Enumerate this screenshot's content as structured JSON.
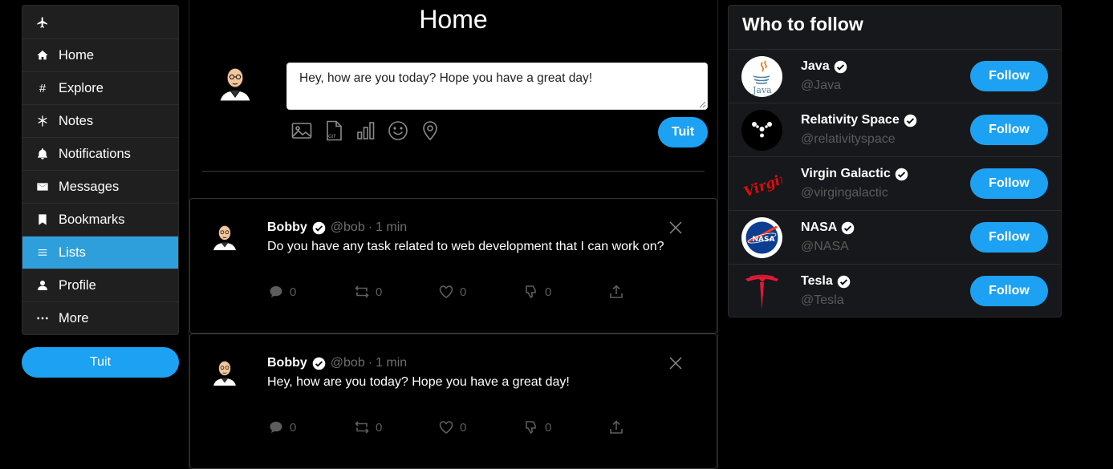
{
  "sidebar": {
    "items": [
      {
        "label": "",
        "icon": "airplane-icon"
      },
      {
        "label": "Home",
        "icon": "home-icon"
      },
      {
        "label": "Explore",
        "icon": "hashtag-icon"
      },
      {
        "label": "Notes",
        "icon": "asterisk-icon"
      },
      {
        "label": "Notifications",
        "icon": "bell-icon"
      },
      {
        "label": "Messages",
        "icon": "envelope-icon"
      },
      {
        "label": "Bookmarks",
        "icon": "bookmark-icon"
      },
      {
        "label": "Lists",
        "icon": "list-icon",
        "active": true
      },
      {
        "label": "Profile",
        "icon": "user-icon"
      },
      {
        "label": "More",
        "icon": "more-icon"
      }
    ],
    "tuit_label": "Tuit"
  },
  "main": {
    "title": "Home",
    "compose": {
      "text": "Hey, how are you today? Hope you have a great day!",
      "tools": [
        "image-icon",
        "gif-icon",
        "poll-icon",
        "emoji-icon",
        "location-icon"
      ],
      "tuit_label": "Tuit"
    },
    "tweets": [
      {
        "name": "Bobby",
        "handle": "@bob",
        "separator": "·",
        "time": "1 min",
        "text": "Do you have any task related to web development that I can work on?",
        "replies": "0",
        "retuits": "0",
        "likes": "0",
        "dislikes": "0"
      },
      {
        "name": "Bobby",
        "handle": "@bob",
        "separator": "·",
        "time": "1 min",
        "text": "Hey, how are you today? Hope you have a great day!",
        "replies": "0",
        "retuits": "0",
        "likes": "0",
        "dislikes": "0"
      }
    ]
  },
  "who_to_follow": {
    "title": "Who to follow",
    "button_label": "Follow",
    "accounts": [
      {
        "name": "Java",
        "handle": "@Java",
        "logo_text": "Java",
        "logo": "java-logo"
      },
      {
        "name": "Relativity Space",
        "handle": "@relativityspace",
        "logo": "relativity-logo"
      },
      {
        "name": "Virgin Galactic",
        "handle": "@virgingalactic",
        "logo_text": "Virgin",
        "logo": "virgin-logo"
      },
      {
        "name": "NASA",
        "handle": "@NASA",
        "logo_text": "NASA",
        "logo": "nasa-logo"
      },
      {
        "name": "Tesla",
        "handle": "@Tesla",
        "logo": "tesla-logo"
      }
    ]
  },
  "colors": {
    "accent": "#1da1f2",
    "active_nav": "#2f9fdb",
    "panel": "#1f1f1f",
    "muted": "#6e6e6e"
  }
}
